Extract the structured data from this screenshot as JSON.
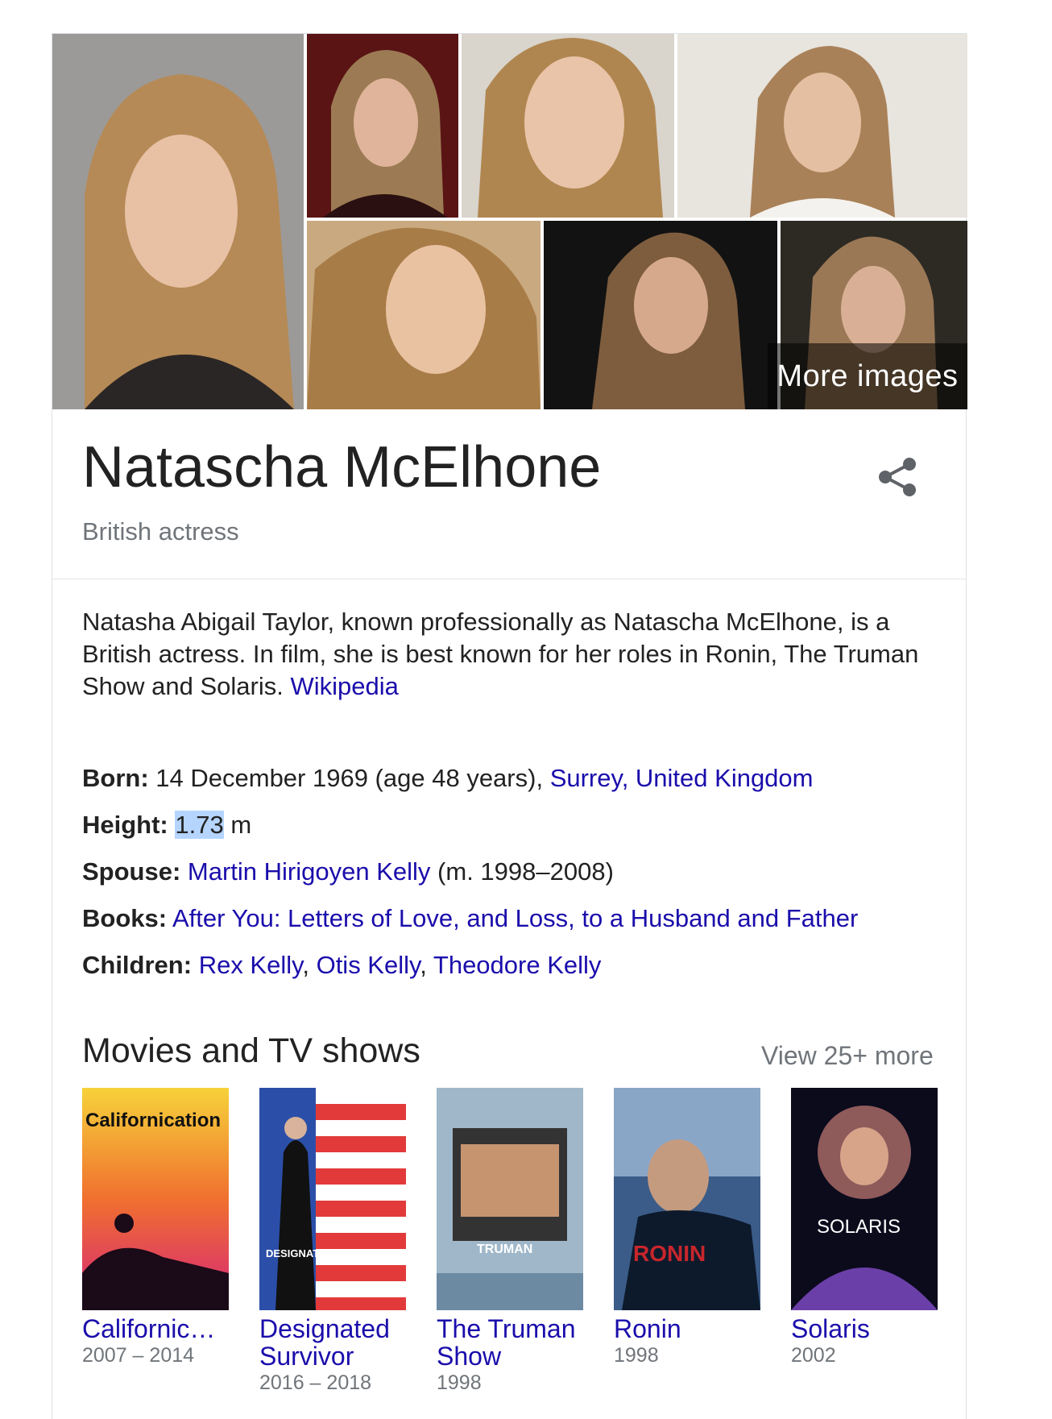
{
  "header": {
    "more_images": "More images",
    "name": "Natascha McElhone",
    "subtitle": "British actress",
    "share_icon": "share-icon"
  },
  "description": {
    "text": "Natasha Abigail Taylor, known professionally as Natascha McElhone, is a British actress. In film, she is best known for her roles in Ronin, The Truman Show and Solaris.",
    "source": "Wikipedia"
  },
  "facts": {
    "born_label": "Born:",
    "born_text": "14 December 1969 (age 48 years),",
    "born_place": "Surrey, United Kingdom",
    "height_label": "Height:",
    "height_value": "1.73",
    "height_unit": "m",
    "spouse_label": "Spouse:",
    "spouse_name": "Martin Hirigoyen Kelly",
    "spouse_years": "(m. 1998–2008)",
    "books_label": "Books:",
    "books_title": "After You: Letters of Love, and Loss, to a Husband and Father",
    "children_label": "Children:",
    "children": [
      "Rex Kelly",
      "Otis Kelly",
      "Theodore Kelly"
    ]
  },
  "movies": {
    "section_title": "Movies and TV shows",
    "view_more": "View 25+ more",
    "items": [
      {
        "title": "Californic…",
        "years": "2007 – 2014",
        "poster_text": "Californication"
      },
      {
        "title": "Designated Survivor",
        "years": "2016 – 2018",
        "poster_text": "DESIGNATED SURVIVOR"
      },
      {
        "title": "The Truman Show",
        "years": "1998",
        "poster_text": "TRUMAN"
      },
      {
        "title": "Ronin",
        "years": "1998",
        "poster_text": "RONIN"
      },
      {
        "title": "Solaris",
        "years": "2002",
        "poster_text": "SOLARIS"
      }
    ]
  }
}
